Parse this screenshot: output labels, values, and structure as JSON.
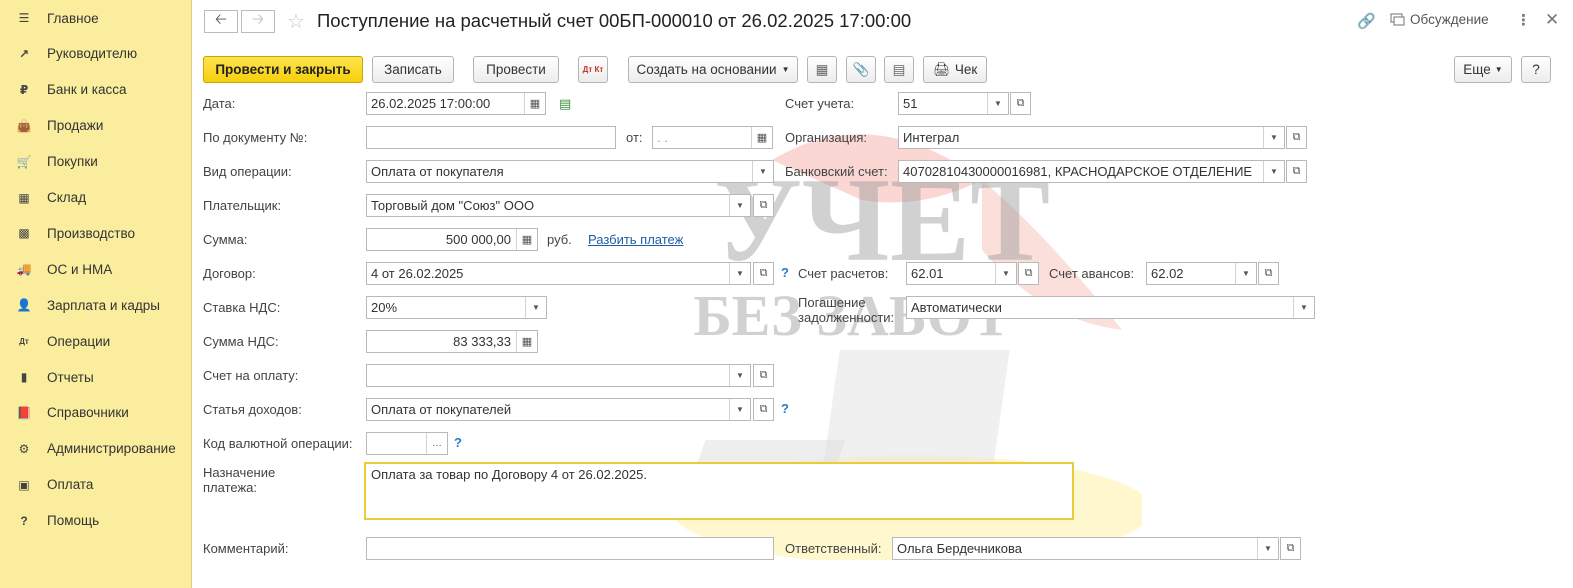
{
  "sidebar": {
    "items": [
      {
        "label": "Главное",
        "icon": "menu-icon"
      },
      {
        "label": "Руководителю",
        "icon": "trend-icon"
      },
      {
        "label": "Банк и касса",
        "icon": "ruble-icon"
      },
      {
        "label": "Продажи",
        "icon": "bag-icon"
      },
      {
        "label": "Покупки",
        "icon": "cart-icon"
      },
      {
        "label": "Склад",
        "icon": "grid-icon"
      },
      {
        "label": "Производство",
        "icon": "factory-icon"
      },
      {
        "label": "ОС и НМА",
        "icon": "truck-icon"
      },
      {
        "label": "Зарплата и кадры",
        "icon": "person-icon"
      },
      {
        "label": "Операции",
        "icon": "dt-kt-icon"
      },
      {
        "label": "Отчеты",
        "icon": "bar-chart-icon"
      },
      {
        "label": "Справочники",
        "icon": "book-icon"
      },
      {
        "label": "Администрирование",
        "icon": "gear-icon"
      },
      {
        "label": "Оплата",
        "icon": "wallet-icon"
      },
      {
        "label": "Помощь",
        "icon": "question-icon"
      }
    ]
  },
  "header": {
    "title": "Поступление на расчетный счет 00БП-000010 от 26.02.2025 17:00:00",
    "discussion": "Обсуждение"
  },
  "toolbar": {
    "post_close": "Провести и закрыть",
    "save": "Записать",
    "post": "Провести",
    "create_based": "Создать на основании",
    "check": "Чек",
    "more": "Еще",
    "help": "?",
    "dt_kt": "Дт Кт"
  },
  "form": {
    "date_label": "Дата:",
    "date_value": "26.02.2025 17:00:00",
    "doc_num_label": "По документу №:",
    "doc_num_value": "",
    "from_label": "от:",
    "from_value": " .  .",
    "operation_label": "Вид операции:",
    "operation_value": "Оплата от покупателя",
    "payer_label": "Плательщик:",
    "payer_value": "Торговый дом \"Союз\" ООО",
    "sum_label": "Сумма:",
    "sum_value": "500 000,00",
    "currency": "руб.",
    "split_link": "Разбить платеж",
    "contract_label": "Договор:",
    "contract_value": "4 от 26.02.2025",
    "vat_rate_label": "Ставка НДС:",
    "vat_rate_value": "20%",
    "vat_sum_label": "Сумма НДС:",
    "vat_sum_value": "83 333,33",
    "invoice_label": "Счет на оплату:",
    "invoice_value": "",
    "income_label": "Статья доходов:",
    "income_value": "Оплата от покупателей",
    "currency_op_label": "Код валютной операции:",
    "currency_op_value": "",
    "purpose_label": "Назначение платежа:",
    "purpose_value": "Оплата за товар по Договору 4 от 26.02.2025.",
    "comment_label": "Комментарий:",
    "comment_value": "",
    "account_label": "Счет учета:",
    "account_value": "51",
    "org_label": "Организация:",
    "org_value": "Интеграл",
    "bank_label": "Банковский счет:",
    "bank_value": "40702810430000016981, КРАСНОДАРСКОЕ ОТДЕЛЕНИЕ",
    "settle_label": "Счет расчетов:",
    "settle_value": "62.01",
    "advance_label": "Счет авансов:",
    "advance_value": "62.02",
    "debt_label": "Погашение задолженности:",
    "debt_value": "Автоматически",
    "responsible_label": "Ответственный:",
    "responsible_value": "Ольга Бердечникова",
    "help_mark": "?"
  },
  "watermark": {
    "line1": "УЧЕТ",
    "line2": "БЕЗ ЗАБОТ"
  }
}
